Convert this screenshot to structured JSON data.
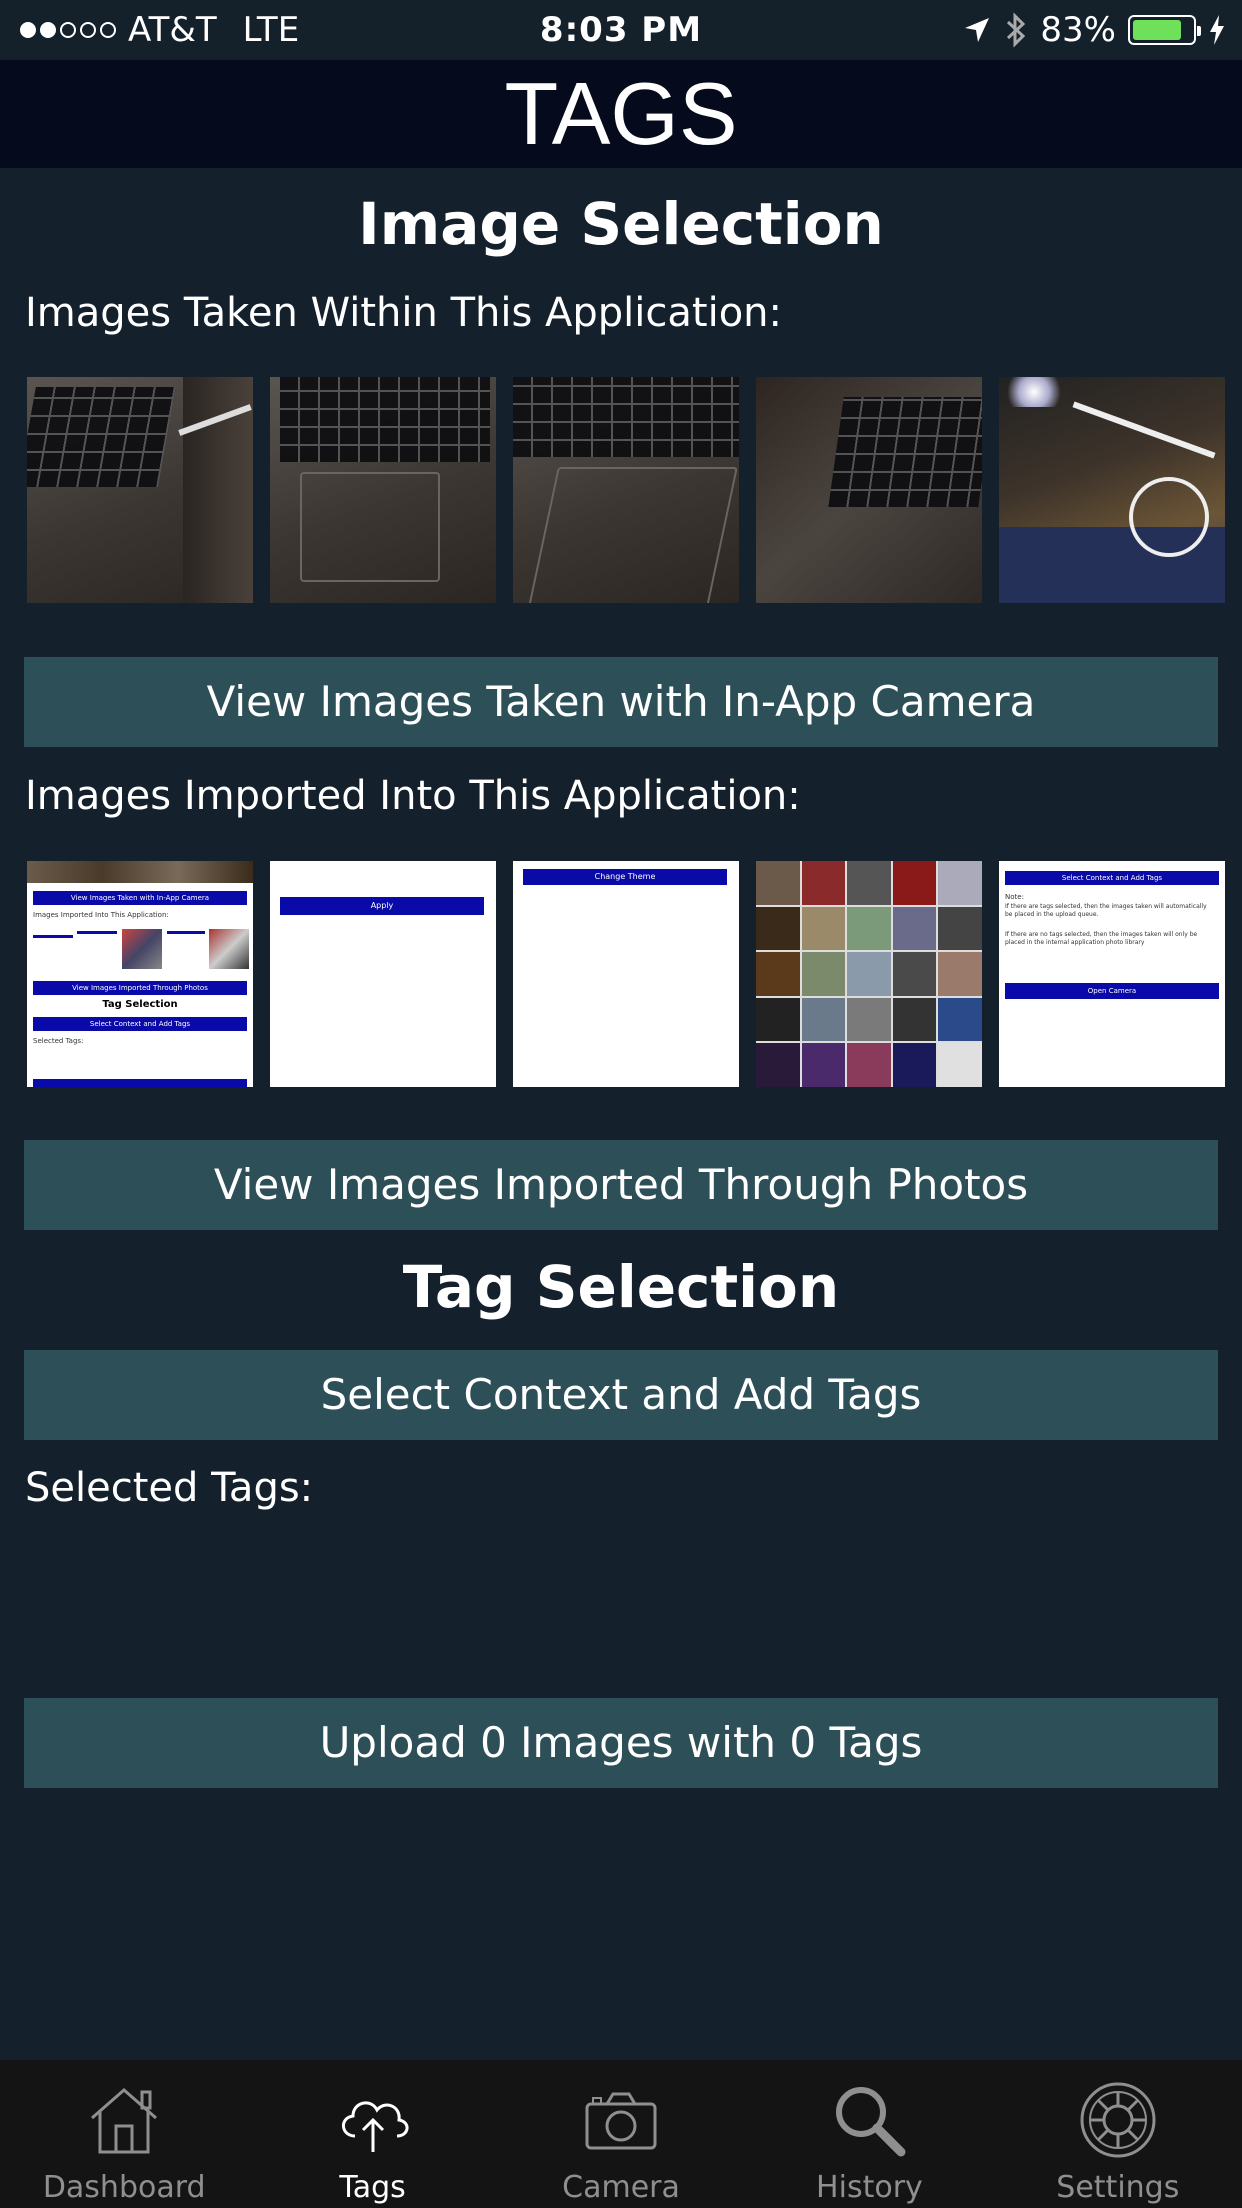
{
  "status": {
    "carrier": "AT&T",
    "network": "LTE",
    "time": "8:03 PM",
    "battery": "83%",
    "battery_level": 0.83,
    "signal_bars": 2
  },
  "header": {
    "title": "TAGS"
  },
  "image_selection": {
    "title": "Image Selection",
    "camera_label": "Images Taken Within This Application:",
    "camera_button": "View Images Taken with In-App Camera",
    "imported_label": "Images Imported Into This Application:",
    "imported_button": "View Images Imported Through Photos"
  },
  "tag_selection": {
    "title": "Tag Selection",
    "button": "Select Context and Add Tags",
    "selected_label": "Selected Tags:"
  },
  "upload_button": "Upload 0 Images with 0 Tags",
  "thumb_text": {
    "t1_btn1": "View Images Taken with In-App Camera",
    "t1_label": "Images Imported Into This Application:",
    "t1_btn2": "View Images Imported Through Photos",
    "t1_title": "Tag Selection",
    "t1_btn3": "Select Context and Add Tags",
    "t1_sel": "Selected Tags:",
    "t2_btn": "Apply",
    "t3_btn": "Change Theme",
    "t5_btn1": "Select Context and Add Tags",
    "t5_note": "Note:",
    "t5_line1": "If there are tags selected, then the images taken will automatically be placed in the upload queue.",
    "t5_line2": "If there are no tags selected, then the images taken will only be placed in the internal application photo library",
    "t5_btn2": "Open Camera"
  },
  "tabs": [
    {
      "label": "Dashboard",
      "icon": "house-icon",
      "active": false
    },
    {
      "label": "Tags",
      "icon": "cloud-upload-icon",
      "active": true
    },
    {
      "label": "Camera",
      "icon": "camera-icon",
      "active": false
    },
    {
      "label": "History",
      "icon": "magnifier-icon",
      "active": false
    },
    {
      "label": "Settings",
      "icon": "gear-icon",
      "active": false
    }
  ]
}
